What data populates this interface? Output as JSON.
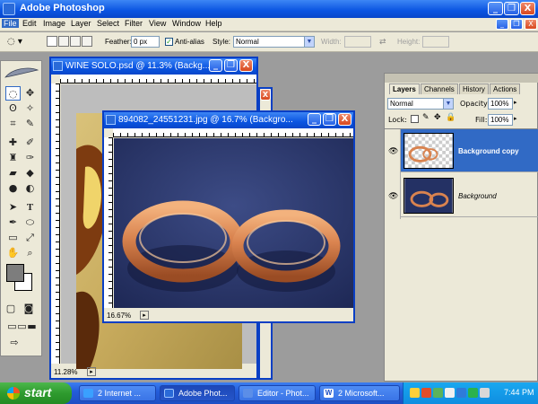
{
  "app": {
    "title": "Adobe Photoshop",
    "window_controls": {
      "minimize": "_",
      "restore": "❐",
      "close": "X"
    }
  },
  "menu": {
    "items": [
      "File",
      "Edit",
      "Image",
      "Layer",
      "Select",
      "Filter",
      "View",
      "Window",
      "Help"
    ]
  },
  "options_bar": {
    "feather_label": "Feather:",
    "feather_value": "0 px",
    "antialias_label": "Anti-alias",
    "style_label": "Style:",
    "style_value": "Normal",
    "width_label": "Width:",
    "height_label": "Height:"
  },
  "documents": [
    {
      "title": "WINE SOLO.psd @ 11.3% (Backg...",
      "zoom": "11.28%"
    },
    {
      "title": "894082_24551231.jpg @ 16.7% (Backgro...",
      "zoom": "16.67%"
    }
  ],
  "layers_palette": {
    "tabs": [
      "Layers",
      "Channels",
      "History",
      "Actions"
    ],
    "blend_mode": "Normal",
    "opacity_label": "Opacity:",
    "opacity_value": "100%",
    "lock_label": "Lock:",
    "fill_label": "Fill:",
    "fill_value": "100%",
    "layers": [
      {
        "name": "Background copy",
        "selected": true
      },
      {
        "name": "Background",
        "selected": false
      }
    ]
  },
  "taskbar": {
    "start_label": "start",
    "tasks": [
      "2 Internet ...",
      "Adobe Phot...",
      "Editor - Phot...",
      "2 Microsoft..."
    ],
    "clock": "7:44 PM"
  },
  "colors": {
    "xp_blue": "#0a54e1",
    "start_green": "#2e9b2e",
    "photo_blue": "#243164",
    "ring_copper": "#d9834f",
    "selected_layer": "#316ac5"
  }
}
